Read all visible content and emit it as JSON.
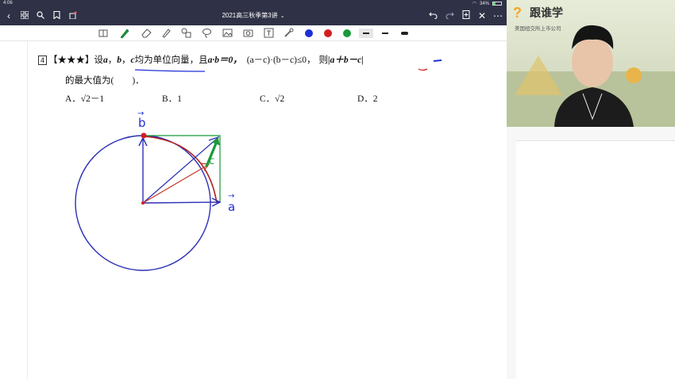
{
  "status": {
    "time": "4:06",
    "battery": "34%"
  },
  "header": {
    "title": "2021高三秋季第3讲",
    "title_chevron": "⌄"
  },
  "colors": {
    "header_bg": "#2f3146",
    "pen_blue": "#1f2fd6",
    "pen_red": "#d41e1e",
    "pen_green": "#1a9a3a",
    "pen_darkred": "#b22222"
  },
  "question": {
    "number": "4",
    "stars": "【★★★】",
    "line1_pre": "设",
    "a": "a",
    "b": "b",
    "c": "c",
    "sep": "，",
    "unit": "均为单位向量，且",
    "dot_expr": "a·b＝0，",
    "ineq": "(a－c)·(b－c)≤0，",
    "then": "则",
    "abs_expr": "|a＋b－c|",
    "line2": "的最大值为(　　)．",
    "options": [
      "A．√2－1",
      "B．1",
      "C．√2",
      "D．2"
    ]
  },
  "annotations": {
    "b_label": "b",
    "a_label": "a",
    "c_label": "c",
    "arrow": "→"
  },
  "brand": {
    "name": "跟谁学",
    "mark": "?",
    "subtitle": "美国纽交所上市公司"
  }
}
